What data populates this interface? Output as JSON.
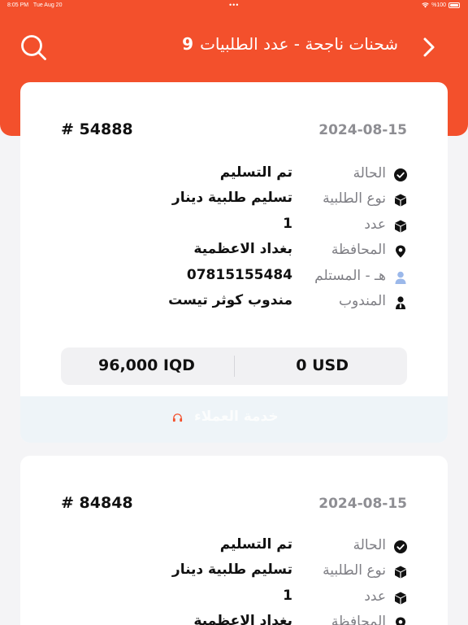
{
  "statusbar": {
    "time": "8:05 PM",
    "date": "Tue Aug 20",
    "battery": "%100"
  },
  "header": {
    "title": "شحنات ناجحة - عدد الطلبيات",
    "count": "9",
    "search_icon": "search-icon",
    "back_icon": "chevron-right-icon"
  },
  "colors": {
    "brand": "#f3502c",
    "muted": "#8e8e93",
    "user_icon": "#9bb8ea"
  },
  "labels": {
    "status": "الحالة",
    "order_type": "نوع الطلبية",
    "count": "عدد",
    "province": "المحافظة",
    "recipient_phone": "هـ - المستلم",
    "agent": "المندوب",
    "support": "خدمة العملاء"
  },
  "orders": [
    {
      "id": "# 54888",
      "date": "2024-08-15",
      "status": "تم التسليم",
      "order_type": "تسليم طلبية دينار",
      "count": "1",
      "province": "بغداد الاعظمية",
      "recipient_phone": "07815155484",
      "agent": "مندوب كوثر تيست",
      "total_usd": "0 USD",
      "total_iqd": "96,000 IQD"
    },
    {
      "id": "# 84848",
      "date": "2024-08-15",
      "status": "تم التسليم",
      "order_type": "تسليم طلبية دينار",
      "count": "1",
      "province": "بغداد الاعظمية"
    }
  ]
}
